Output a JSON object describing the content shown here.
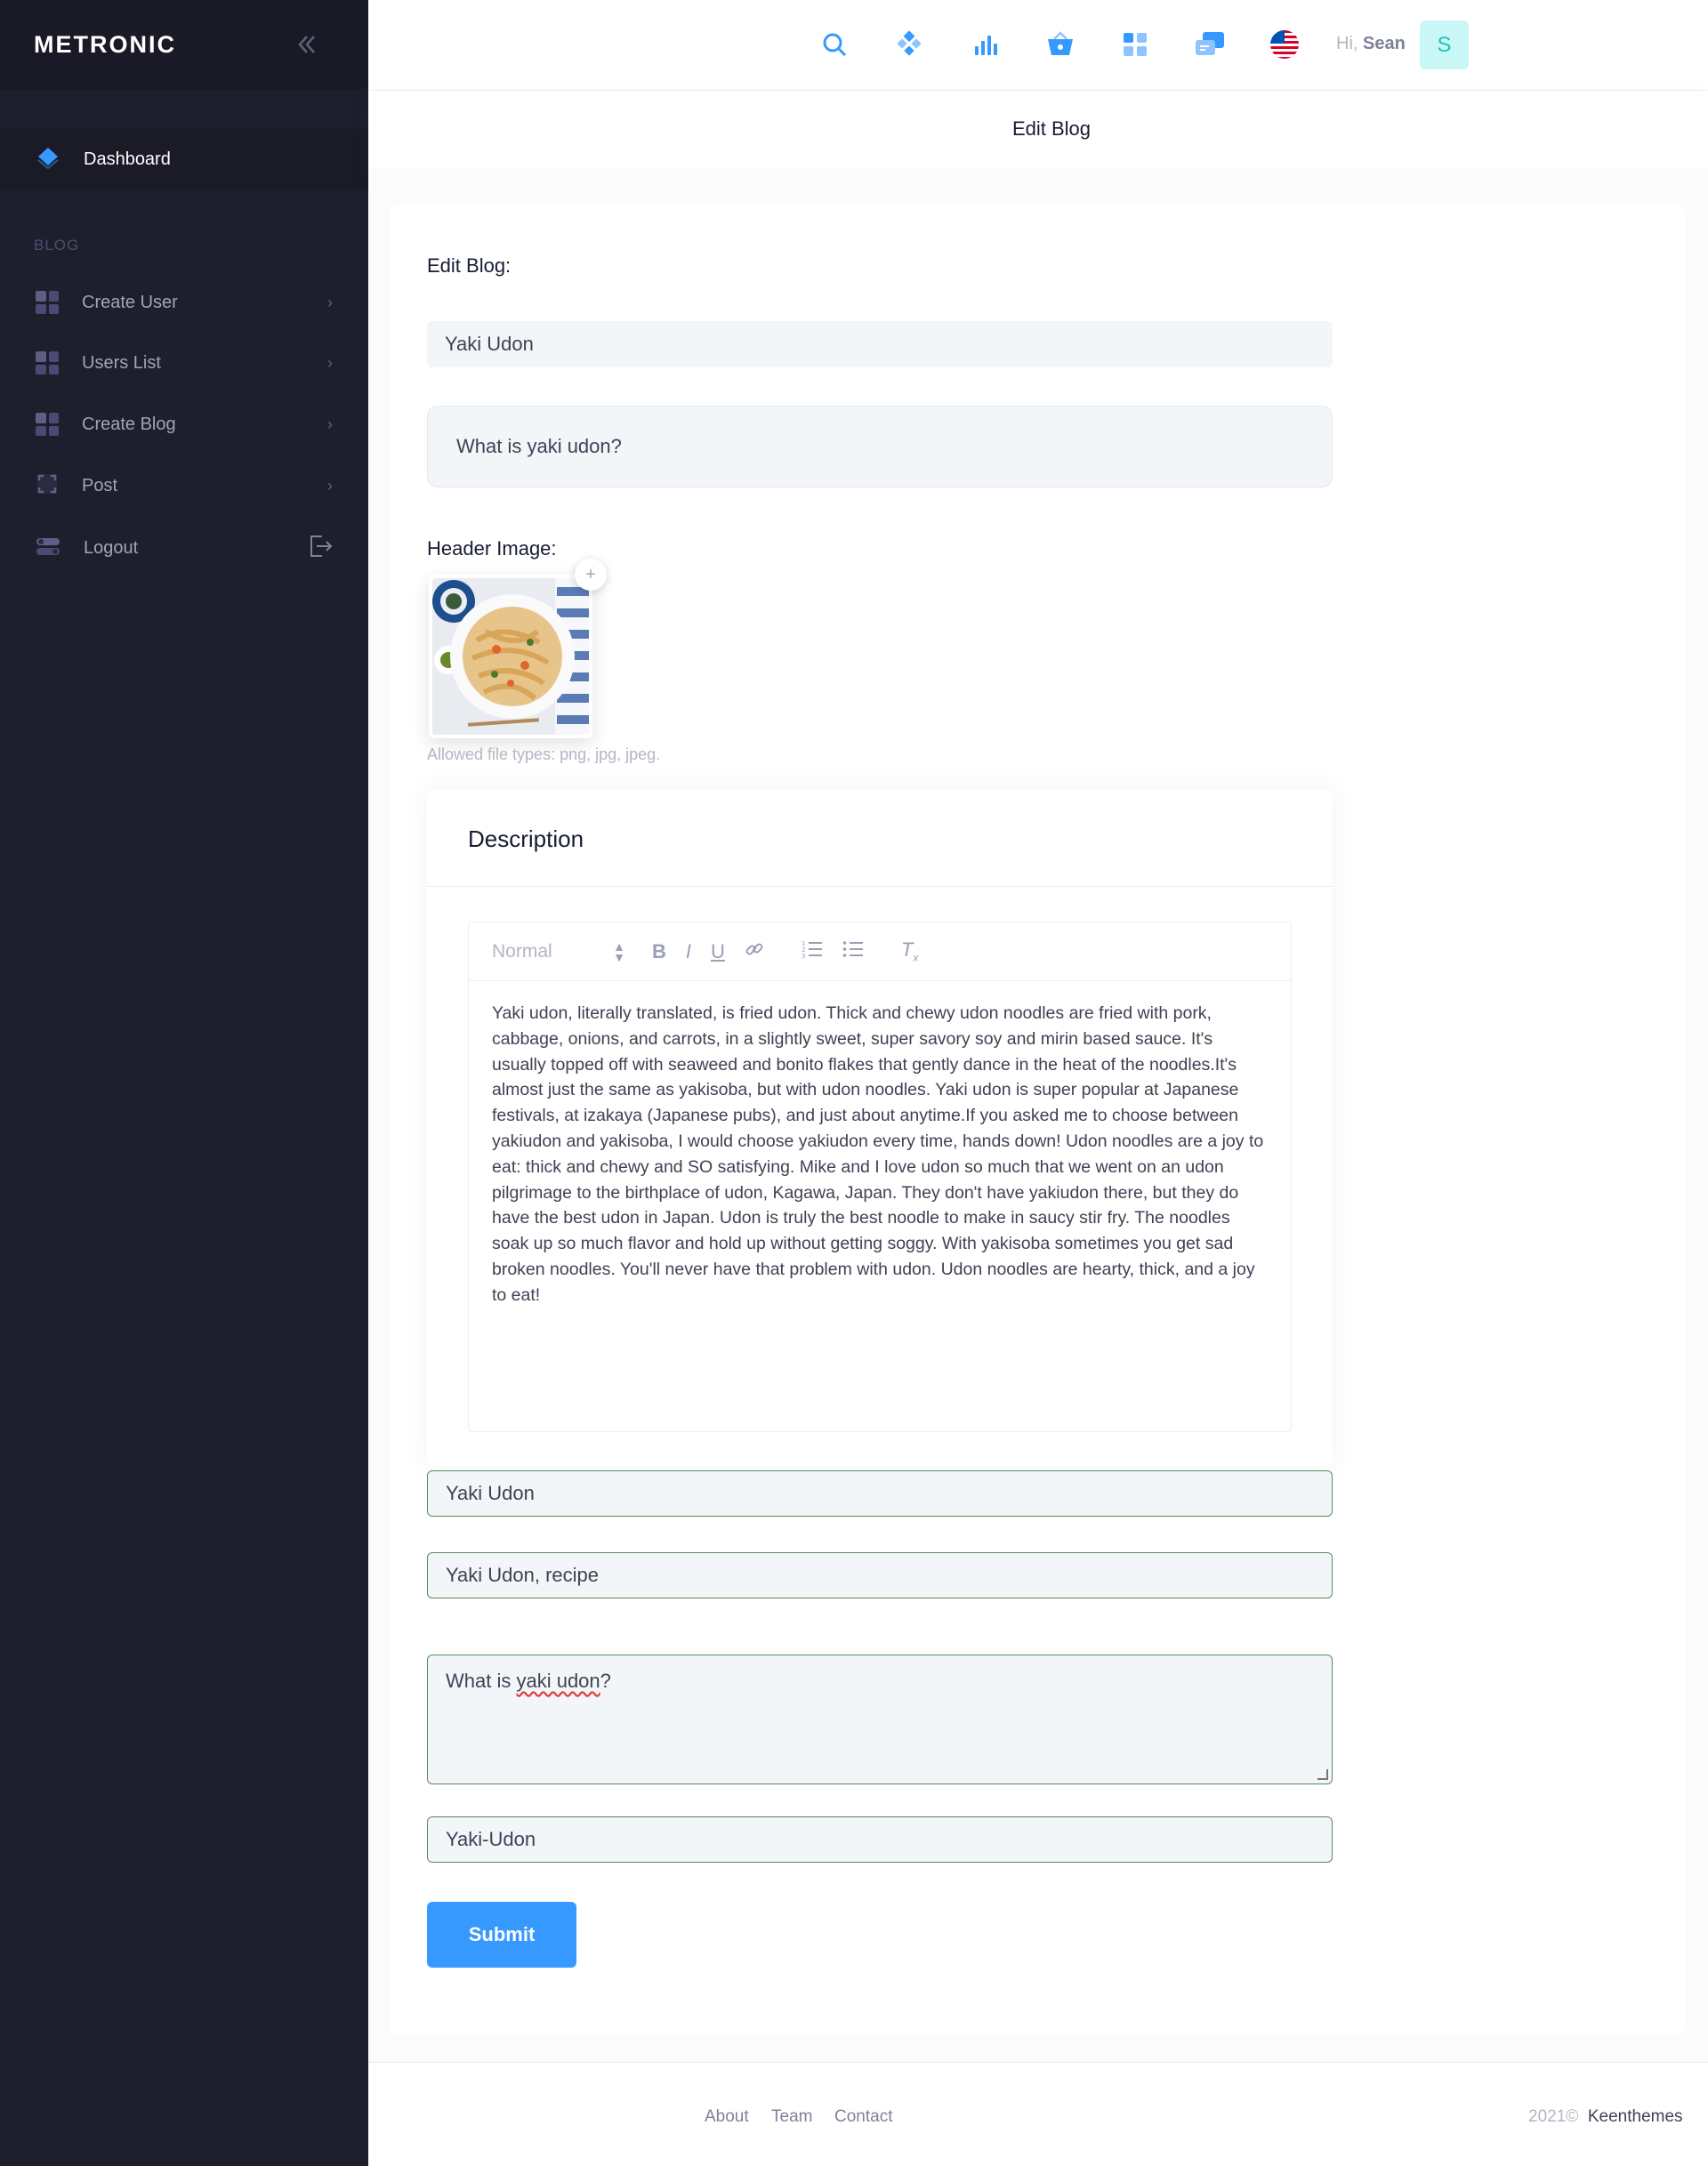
{
  "sidebar": {
    "brand": "METRONIC",
    "active_item": "Dashboard",
    "section": "BLOG",
    "items": [
      {
        "label": "Create User"
      },
      {
        "label": "Users List"
      },
      {
        "label": "Create Blog"
      },
      {
        "label": "Post"
      },
      {
        "label": "Logout"
      }
    ]
  },
  "header": {
    "greeting": "Hi,",
    "user_name": "Sean",
    "avatar_initial": "S",
    "icons": [
      "search-icon",
      "layers-icon",
      "chart-icon",
      "basket-icon",
      "apps-icon",
      "chat-icon",
      "us-flag-icon"
    ]
  },
  "subheader": {
    "title": "Edit Blog"
  },
  "form": {
    "heading": "Edit Blog:",
    "title_value": "Yaki Udon",
    "subtitle_value": "What is yaki udon?",
    "header_image_label": "Header Image:",
    "image_hint": "Allowed file types: png, jpg, jpeg.",
    "description_title": "Description",
    "editor_format": "Normal",
    "description_text": "Yaki udon, literally translated, is fried udon. Thick and chewy udon noodles are fried with pork, cabbage, onions, and carrots, in a slightly sweet, super savory soy and mirin based sauce. It's usually topped off with seaweed and bonito flakes that gently dance in the heat of the noodles.It's almost just the same as yakisoba, but with udon noodles. Yaki udon is super popular at Japanese festivals, at izakaya (Japanese pubs), and just about anytime.If you asked me to choose between yakiudon and yakisoba, I would choose yakiudon every time, hands down! Udon noodles are a joy to eat: thick and chewy and SO satisfying. Mike and I love udon so much that we went on an udon pilgrimage to the birthplace of udon, Kagawa, Japan. They don't have yakiudon there, but they do have the best udon in Japan. Udon is truly the best noodle to make in saucy stir fry. The noodles soak up so much flavor and hold up without getting soggy. With yakisoba sometimes you get sad broken noodles. You'll never have that problem with udon. Udon noodles are hearty, thick, and a joy to eat!",
    "meta_title_value": "Yaki Udon",
    "keywords_value": "Yaki Udon, recipe",
    "meta_desc_prefix": "What is ",
    "meta_desc_spell": "yaki udon",
    "meta_desc_suffix": "?",
    "slug_value": "Yaki-Udon",
    "submit_label": "Submit"
  },
  "footer": {
    "links": [
      "About",
      "Team",
      "Contact"
    ],
    "year": "2021©",
    "company": "Keenthemes"
  },
  "colors": {
    "sidebar_bg": "#1e1e2d",
    "primary": "#3699ff",
    "valid_border": "#5a8a5a",
    "avatar_bg": "#c9f7f5"
  }
}
